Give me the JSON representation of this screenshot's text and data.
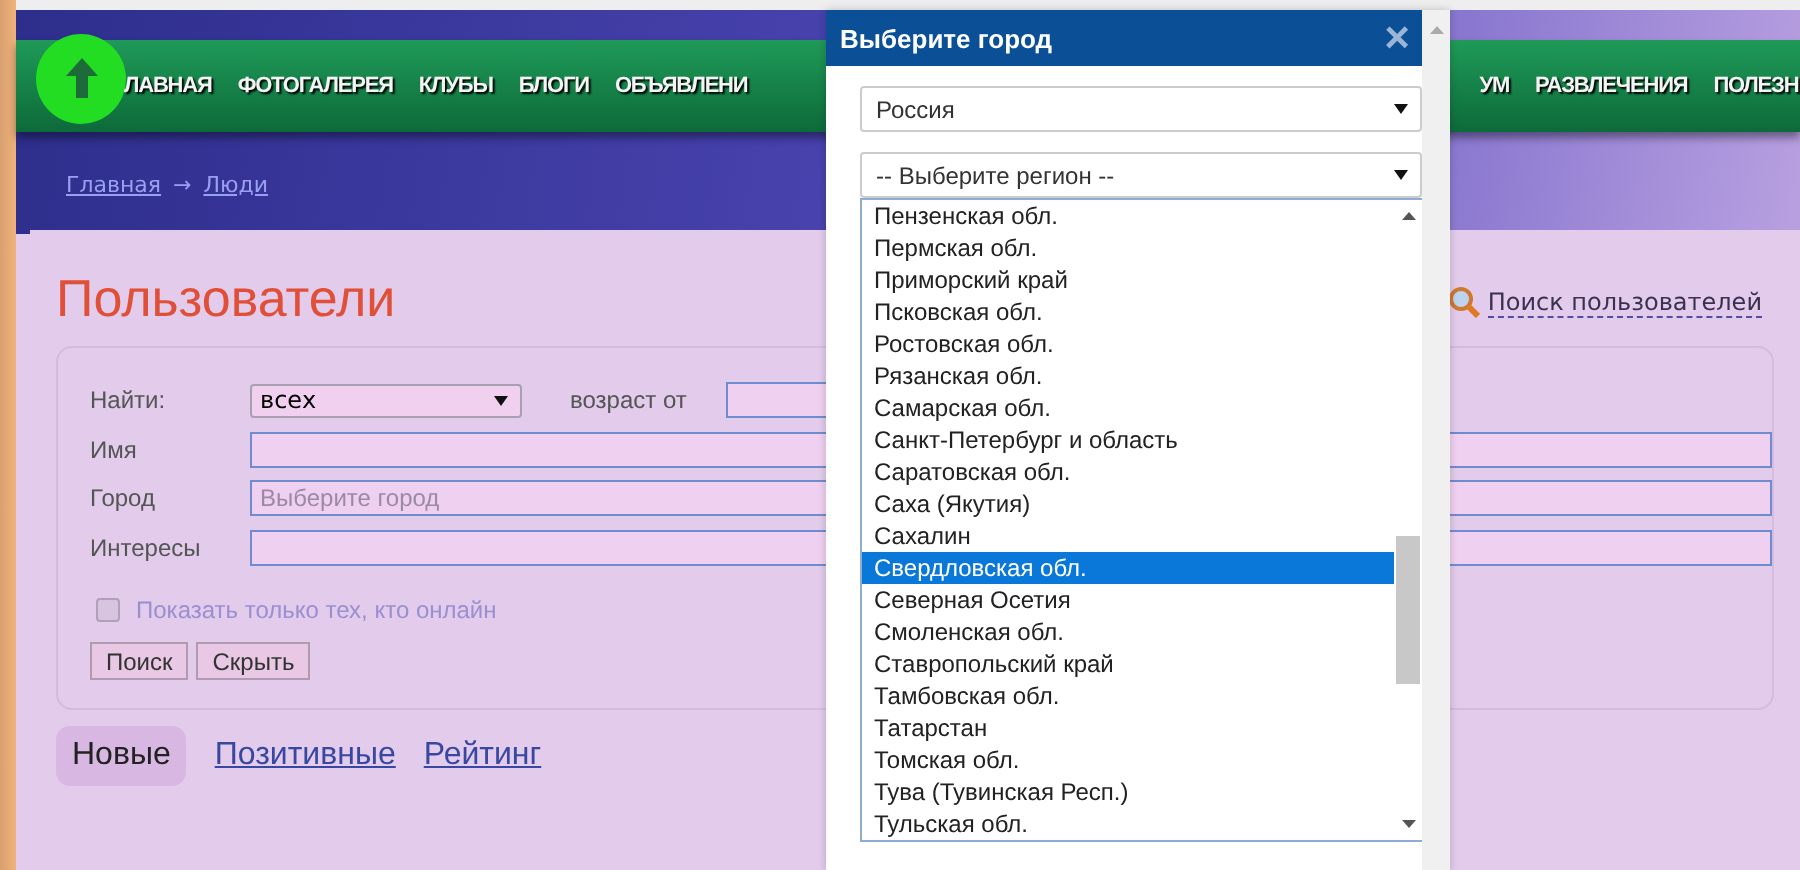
{
  "nav": {
    "items": [
      {
        "label": "ЛАВНАЯ"
      },
      {
        "label": "ФОТОГАЛЕРЕЯ"
      },
      {
        "label": "КЛУБЫ"
      },
      {
        "label": "БЛОГИ"
      },
      {
        "label": "ОБЪЯВЛЕНИ"
      },
      {
        "label": "УМ"
      },
      {
        "label": "РАЗВЛЕЧЕНИЯ"
      },
      {
        "label": "ПОЛЕЗН"
      }
    ]
  },
  "breadcrumb": {
    "items": [
      "Главная",
      "Люди"
    ],
    "separator": "→"
  },
  "page_title": "Пользователи",
  "search_link": "Поиск пользователей",
  "search_form": {
    "find": {
      "label": "Найти:",
      "value": "всех"
    },
    "age": {
      "label": "возраст от"
    },
    "fields": [
      {
        "label": "Имя"
      },
      {
        "label": "Город",
        "placeholder": "Выберите город"
      },
      {
        "label": "Интересы"
      }
    ],
    "online_only": {
      "label": "Показать только тех, кто онлайн",
      "checked": false
    },
    "buttons": [
      "Поиск",
      "Скрыть"
    ]
  },
  "tabs": [
    {
      "label": "Новые",
      "selected": true
    },
    {
      "label": "Позитивные",
      "selected": false
    },
    {
      "label": "Рейтинг",
      "selected": false
    }
  ],
  "dialog": {
    "title": "Выберите город",
    "close": "×",
    "country": "Россия",
    "region": "-- Выберите регион --",
    "regions": [
      {
        "label": "Пензенская обл.",
        "selected": false
      },
      {
        "label": "Пермская обл.",
        "selected": false
      },
      {
        "label": "Приморский край",
        "selected": false
      },
      {
        "label": "Псковская обл.",
        "selected": false
      },
      {
        "label": "Ростовская обл.",
        "selected": false
      },
      {
        "label": "Рязанская обл.",
        "selected": false
      },
      {
        "label": "Самарская обл.",
        "selected": false
      },
      {
        "label": "Санкт-Петербург и область",
        "selected": false
      },
      {
        "label": "Саратовская обл.",
        "selected": false
      },
      {
        "label": "Саха (Якутия)",
        "selected": false
      },
      {
        "label": "Сахалин",
        "selected": false
      },
      {
        "label": "Свердловская обл.",
        "selected": true
      },
      {
        "label": "Северная Осетия",
        "selected": false
      },
      {
        "label": "Смоленская обл.",
        "selected": false
      },
      {
        "label": "Ставропольский край",
        "selected": false
      },
      {
        "label": "Тамбовская обл.",
        "selected": false
      },
      {
        "label": "Татарстан",
        "selected": false
      },
      {
        "label": "Томская обл.",
        "selected": false
      },
      {
        "label": "Тува (Тувинская Респ.)",
        "selected": false
      },
      {
        "label": "Тульская обл.",
        "selected": false
      }
    ]
  }
}
